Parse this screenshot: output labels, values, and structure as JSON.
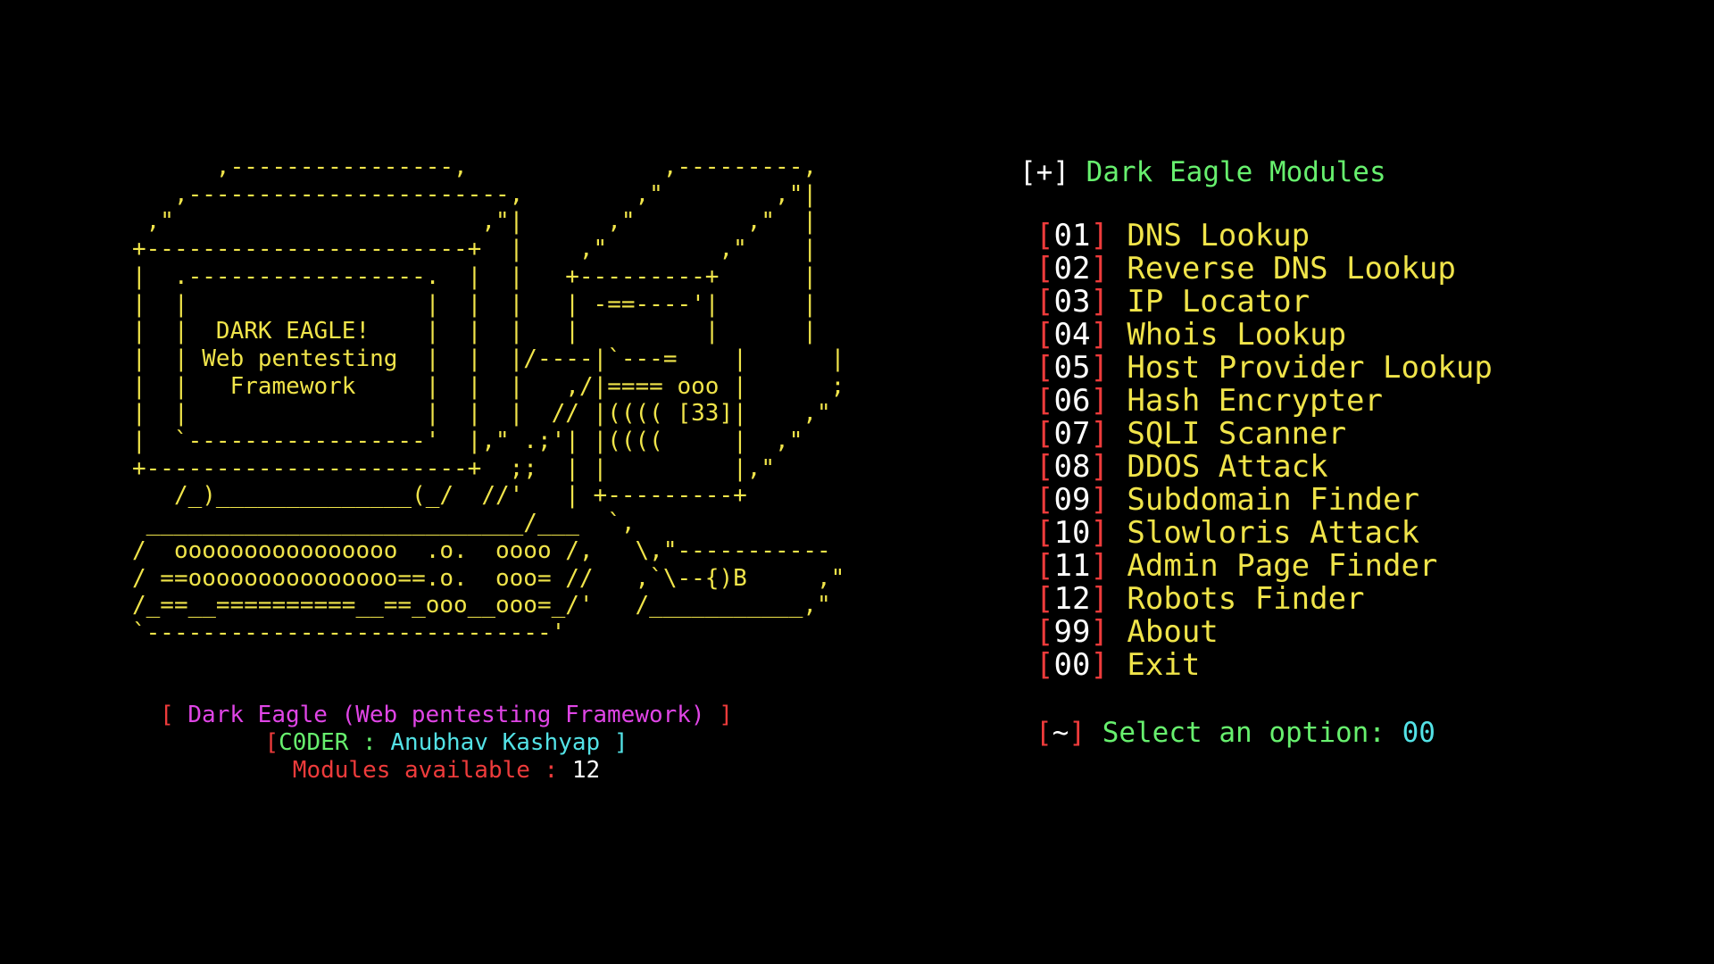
{
  "terminal": {
    "ascii_art": "      ,----------------,              ,---------,\n   ,-----------------------,        ,\"        ,\"|\n ,\"                      ,\"|      ,\"        ,\"  |\n+-----------------------+  |    ,\"        ,\"    |\n|  .-----------------.  |  |   +---------+      |\n|  |                 |  |  |   | -==----'|      |\n|  |  DARK EAGLE!    |  |  |   |         |      |\n|  | Web pentesting  |  |  |/----|`---=    |      |\n|  |   Framework     |  |  |   ,/|==== ooo |      ;\n|  |                 |  |  |  // |(((( [33]|    ,\"\n|  `-----------------'  |,\" .;'| |((((     |  ,\"\n+-----------------------+  ;;  | |         |,\"\n   /_)______________(_/  //'   | +---------+\n ___________________________/___  `,\n/  oooooooooooooooo  .o.  oooo /,   \\,\"-----------\n/ ==ooooooooooooooo==.o.  ooo= //   ,`\\--{)B     ,\"\n/_==__==========__==_ooo__ooo=_/'   /___________,\"\n`-----------------------------'",
    "banner": {
      "title": {
        "open": "[ ",
        "text": "Dark Eagle (Web pentesting Framework)",
        "close": " ]"
      },
      "coder": {
        "open": "[",
        "label": "C0DER : ",
        "name": "Anubhav Kashyap",
        "close": " ]"
      },
      "modules": {
        "label": "Modules available : ",
        "count": "12"
      }
    },
    "modules_header": {
      "prefix": "[+]",
      "title": "Dark Eagle Modules"
    },
    "modules": [
      {
        "num": "01",
        "label": "DNS Lookup"
      },
      {
        "num": "02",
        "label": "Reverse DNS Lookup"
      },
      {
        "num": "03",
        "label": "IP Locator"
      },
      {
        "num": "04",
        "label": "Whois Lookup"
      },
      {
        "num": "05",
        "label": "Host Provider Lookup"
      },
      {
        "num": "06",
        "label": "Hash Encrypter"
      },
      {
        "num": "07",
        "label": "SQLI Scanner"
      },
      {
        "num": "08",
        "label": "DDOS Attack"
      },
      {
        "num": "09",
        "label": "Subdomain Finder"
      },
      {
        "num": "10",
        "label": "Slowloris Attack"
      },
      {
        "num": "11",
        "label": "Admin Page Finder"
      },
      {
        "num": "12",
        "label": "Robots Finder"
      },
      {
        "num": "99",
        "label": "About"
      },
      {
        "num": "00",
        "label": "Exit"
      }
    ],
    "prompt": {
      "open": "[",
      "symbol": "~",
      "close": "]",
      "text": "Select an option:",
      "value": "00"
    },
    "colors": {
      "background": "#000000",
      "art": "#f0e44a",
      "red": "#ee3b3b",
      "magenta": "#e045e6",
      "cyan": "#53e2e6",
      "green": "#67f06e",
      "white": "#ffffff"
    }
  }
}
